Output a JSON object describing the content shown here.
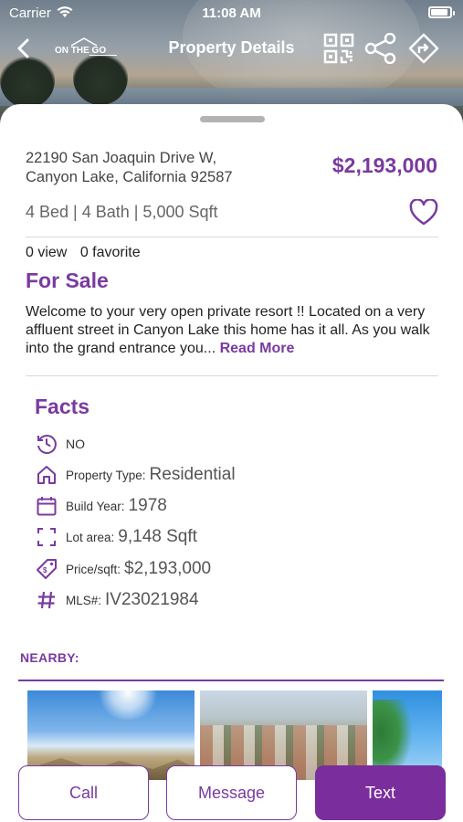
{
  "status_bar": {
    "carrier": "Carrier",
    "time": "11:08 AM"
  },
  "header": {
    "title": "Property Details",
    "logo_text": "ON THE GO"
  },
  "listing": {
    "address_line1": "22190 San Joaquin Drive W,",
    "address_line2": "Canyon Lake, California 92587",
    "price": "$2,193,000",
    "specs": "4 Bed | 4 Bath | 5,000 Sqft",
    "views": "0 view",
    "favorites": "0 favorite",
    "status": "For Sale",
    "description": "Welcome to your very open private resort !! Located on a very affluent street in Canyon Lake this home has it all. As you walk into the grand entrance you... ",
    "read_more": "Read More"
  },
  "facts": {
    "title": "Facts",
    "items": [
      {
        "icon": "clock-history-icon",
        "label": "",
        "value": "NO"
      },
      {
        "icon": "home-icon",
        "label": "Property Type:",
        "value": "Residential"
      },
      {
        "icon": "calendar-icon",
        "label": "Build Year:",
        "value": "1978"
      },
      {
        "icon": "lot-area-icon",
        "label": "Lot area:",
        "value": "9,148 Sqft"
      },
      {
        "icon": "price-tag-icon",
        "label": "Price/sqft:",
        "value": "$2,193,000"
      },
      {
        "icon": "hashtag-icon",
        "label": "MLS#:",
        "value": "IV23021984"
      }
    ]
  },
  "nearby": {
    "title": "NEARBY:"
  },
  "actions": {
    "call": "Call",
    "message": "Message",
    "text": "Text"
  },
  "colors": {
    "accent": "#7a3a9f",
    "accent_dark": "#7a2d9c"
  }
}
